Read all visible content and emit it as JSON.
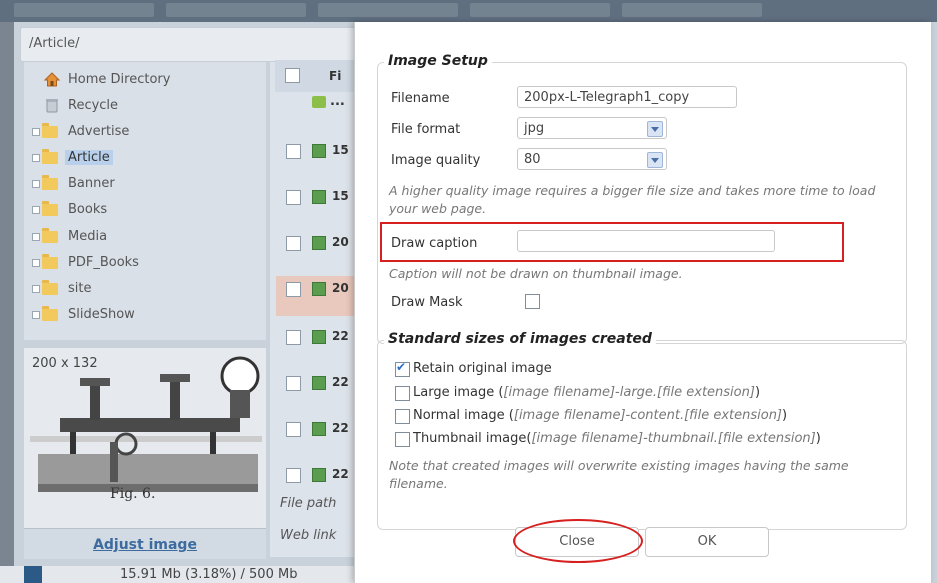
{
  "file_manager": {
    "path": "/Article/",
    "tree": [
      {
        "label": "Home Directory",
        "icon": "home-icon"
      },
      {
        "label": "Recycle",
        "icon": "recycle-icon"
      },
      {
        "label": "Advertise",
        "icon": "folder-icon"
      },
      {
        "label": "Article",
        "icon": "folder-open-icon",
        "selected": true
      },
      {
        "label": "Banner",
        "icon": "folder-icon"
      },
      {
        "label": "Books",
        "icon": "folder-icon"
      },
      {
        "label": "Media",
        "icon": "folder-icon"
      },
      {
        "label": "PDF_Books",
        "icon": "folder-icon"
      },
      {
        "label": "site",
        "icon": "folder-icon"
      },
      {
        "label": "SlideShow",
        "icon": "folder-icon"
      }
    ],
    "column_header": "Fi",
    "up_label": "...",
    "rows": [
      "15",
      "15",
      "20",
      "20",
      "22",
      "22",
      "22",
      "22"
    ],
    "preview_dimensions": "200 x 132",
    "preview_caption": "Fig. 6.",
    "adjust_link": "Adjust image",
    "file_path_label": "File path",
    "web_link_label": "Web link",
    "usage": "15.91 Mb (3.18%) / 500 Mb"
  },
  "dialog": {
    "image_setup": {
      "legend": "Image Setup",
      "filename_label": "Filename",
      "filename_value": "200px-L-Telegraph1_copy",
      "format_label": "File format",
      "format_value": "jpg",
      "quality_label": "Image quality",
      "quality_value": "80",
      "quality_note": "A higher quality image requires a bigger file size and takes more time to load your web page.",
      "caption_label": "Draw caption",
      "caption_value": "",
      "caption_note": "Caption will not be drawn on thumbnail image.",
      "mask_label": "Draw Mask",
      "mask_checked": false
    },
    "standard_sizes": {
      "legend": "Standard sizes of images created",
      "options": [
        {
          "label": "Retain original image",
          "hint": "",
          "checked": true
        },
        {
          "label": "Large image (",
          "hint": "[image filename]-large.[file extension]",
          "suffix": ")",
          "checked": false
        },
        {
          "label": "Normal image (",
          "hint": "[image filename]-content.[file extension]",
          "suffix": ")",
          "checked": false
        },
        {
          "label": "Thumbnail image(",
          "hint": "[image filename]-thumbnail.[file extension]",
          "suffix": ")",
          "checked": false
        }
      ],
      "note": "Note that created images will overwrite existing images having the same filename."
    },
    "close_label": "Close",
    "ok_label": "OK"
  },
  "colors": {
    "annotation": "#d62020",
    "link": "#3d6b9e",
    "selection": "#b8d0ec"
  }
}
